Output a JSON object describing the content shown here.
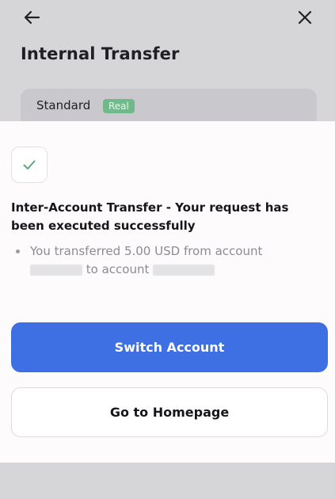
{
  "header": {
    "back_icon": "arrow-left-icon",
    "close_icon": "close-icon",
    "title": "Internal Transfer"
  },
  "account_card": {
    "account_type": "Standard",
    "badge": "Real",
    "badge_color": "#6fb98a"
  },
  "result": {
    "status_icon": "check-icon",
    "status_color": "#5aa878",
    "title": "Inter-Account Transfer - Your request has been executed successfully",
    "detail_prefix": "You transferred 5.00 USD from account",
    "detail_middle": "to account"
  },
  "actions": {
    "primary_label": "Switch Account",
    "primary_color": "#3e6fe3",
    "secondary_label": "Go to Homepage"
  }
}
